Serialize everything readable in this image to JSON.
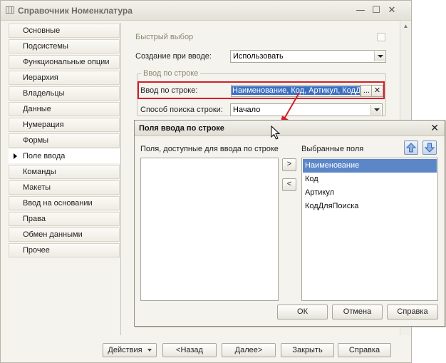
{
  "window": {
    "title": "Справочник Номенклатура",
    "minimize": "—",
    "maximize": "☐",
    "close": "✕"
  },
  "nav": {
    "items": [
      {
        "label": "Основные"
      },
      {
        "label": "Подсистемы"
      },
      {
        "label": "Функциональные опции"
      },
      {
        "label": "Иерархия"
      },
      {
        "label": "Владельцы"
      },
      {
        "label": "Данные"
      },
      {
        "label": "Нумерация"
      },
      {
        "label": "Формы"
      },
      {
        "label": "Поле ввода",
        "active": true
      },
      {
        "label": "Команды"
      },
      {
        "label": "Макеты"
      },
      {
        "label": "Ввод на основании"
      },
      {
        "label": "Права"
      },
      {
        "label": "Обмен данными"
      },
      {
        "label": "Прочее"
      }
    ]
  },
  "settings": {
    "quick_select_label": "Быстрый выбор",
    "create_on_input_label": "Создание при вводе:",
    "create_on_input_value": "Использовать",
    "group_title": "Ввод по строке",
    "input_by_string_label": "Ввод по строке:",
    "input_by_string_value": "Наименование, Код, Артикул, КодД",
    "search_method_label": "Способ поиска строки:",
    "search_method_value": "Начало",
    "ellipsis": "...",
    "clear": "✕"
  },
  "dialog": {
    "title": "Поля ввода по строке",
    "close": "✕",
    "available_label": "Поля, доступные для ввода по строке",
    "selected_label": "Выбранные поля",
    "add_button": ">",
    "remove_button": "<",
    "selected_fields": [
      "Наименование",
      "Код",
      "Артикул",
      "КодДляПоиска"
    ],
    "selected_index": 0,
    "ok": "ОК",
    "cancel": "Отмена",
    "help": "Справка"
  },
  "footer": {
    "actions": "Действия",
    "back": "<Назад",
    "next": "Далее>",
    "close": "Закрыть",
    "help": "Справка"
  },
  "colors": {
    "highlight": "#d31f28",
    "selection": "#5b87c8"
  }
}
